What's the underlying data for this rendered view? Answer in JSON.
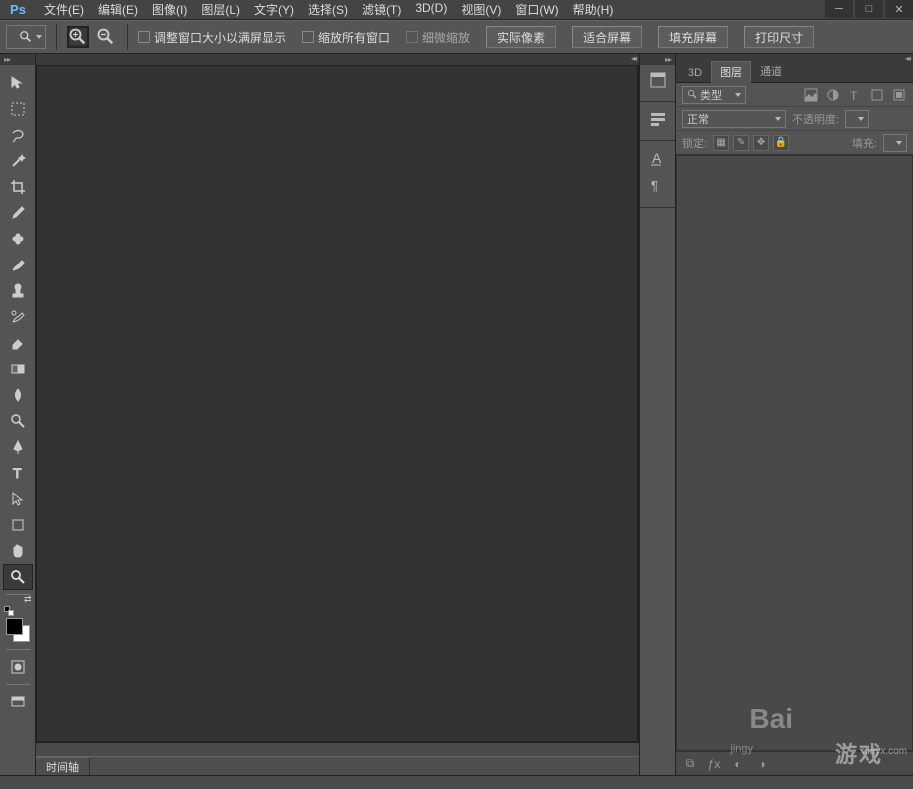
{
  "app": {
    "logo": "Ps"
  },
  "menu": {
    "file": "文件(E)",
    "edit": "编辑(E)",
    "image": "图像(I)",
    "layer": "图层(L)",
    "type": "文字(Y)",
    "select": "选择(S)",
    "filter": "滤镜(T)",
    "three_d": "3D(D)",
    "view": "视图(V)",
    "window": "窗口(W)",
    "help": "帮助(H)"
  },
  "options": {
    "resize_window": "调整窗口大小以满屏显示",
    "zoom_all": "缩放所有窗口",
    "scrubby": "细微缩放",
    "actual": "实际像素",
    "fit": "适合屏幕",
    "fill": "填充屏幕",
    "print": "打印尺寸"
  },
  "timeline": {
    "label": "时间轴"
  },
  "panels": {
    "tabs": {
      "three_d": "3D",
      "layers": "图层",
      "channels": "通道"
    },
    "filter_label": "类型",
    "blend_mode": "正常",
    "opacity_label": "不透明度:",
    "lock_label": "锁定:",
    "fill_label": "填充:"
  },
  "watermark": {
    "site": "xiayx.com",
    "brand": "Bai",
    "small": "jingy",
    "game": "游戏"
  }
}
